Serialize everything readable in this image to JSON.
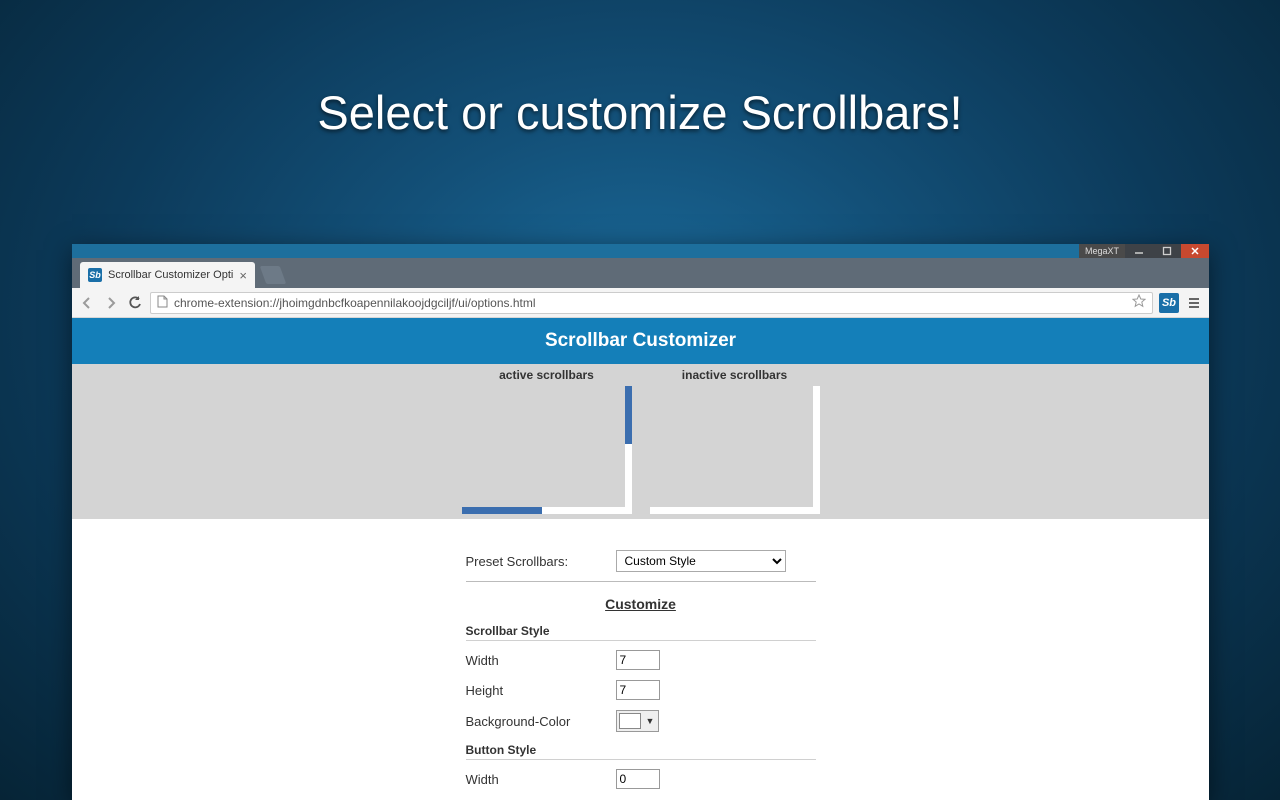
{
  "promo": {
    "title": "Select or customize Scrollbars!"
  },
  "window": {
    "badge": "MegaXT"
  },
  "tab": {
    "title": "Scrollbar Customizer Opti",
    "favicon_text": "Sb"
  },
  "toolbar": {
    "url": "chrome-extension://jhoimgdnbcfkoapennilakoojdgciljf/ui/options.html",
    "ext_text": "Sb"
  },
  "app": {
    "header": "Scrollbar Customizer",
    "preview": {
      "active_label": "active scrollbars",
      "inactive_label": "inactive scrollbars"
    },
    "form": {
      "preset_label": "Preset Scrollbars:",
      "preset_value": "Custom Style",
      "customize_heading": "Customize",
      "scrollbar_style_heading": "Scrollbar Style",
      "width_label": "Width",
      "width_value": "7",
      "height_label": "Height",
      "height_value": "7",
      "bgcolor_label": "Background-Color",
      "button_style_heading": "Button Style",
      "button_width_label": "Width",
      "button_width_value": "0"
    }
  }
}
